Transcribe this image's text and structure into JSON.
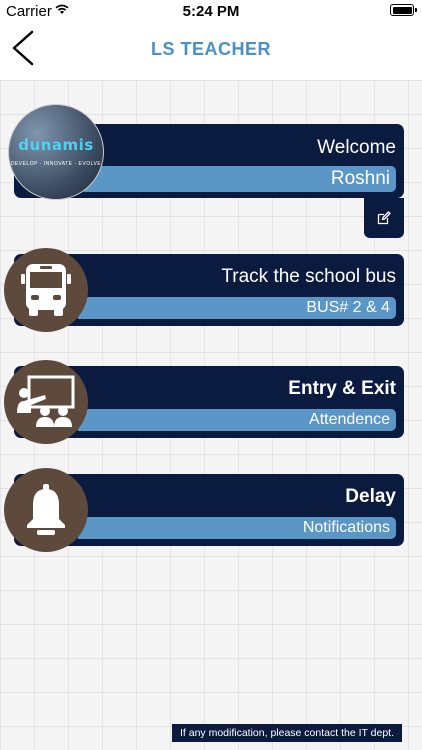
{
  "status_bar": {
    "carrier": "Carrier",
    "time": "5:24 PM"
  },
  "nav": {
    "title": "LS TEACHER"
  },
  "welcome_card": {
    "heading": "Welcome",
    "name": "Roshni",
    "logo_text": "dunamis",
    "logo_tagline": "DEVELOP · INNOVATE · EVOLVE"
  },
  "bus_card": {
    "heading": "Track the school bus",
    "subtitle": "BUS# 2 & 4"
  },
  "attendance_card": {
    "heading": "Entry & Exit",
    "subtitle": "Attendence"
  },
  "delay_card": {
    "heading": "Delay",
    "subtitle": "Notifications"
  },
  "footer": {
    "note": "If any modification, please contact the IT dept."
  },
  "colors": {
    "card_bg": "#0b1a3f",
    "band": "#5b97c6",
    "circle": "#5e4a3c",
    "title": "#4a90c2"
  }
}
